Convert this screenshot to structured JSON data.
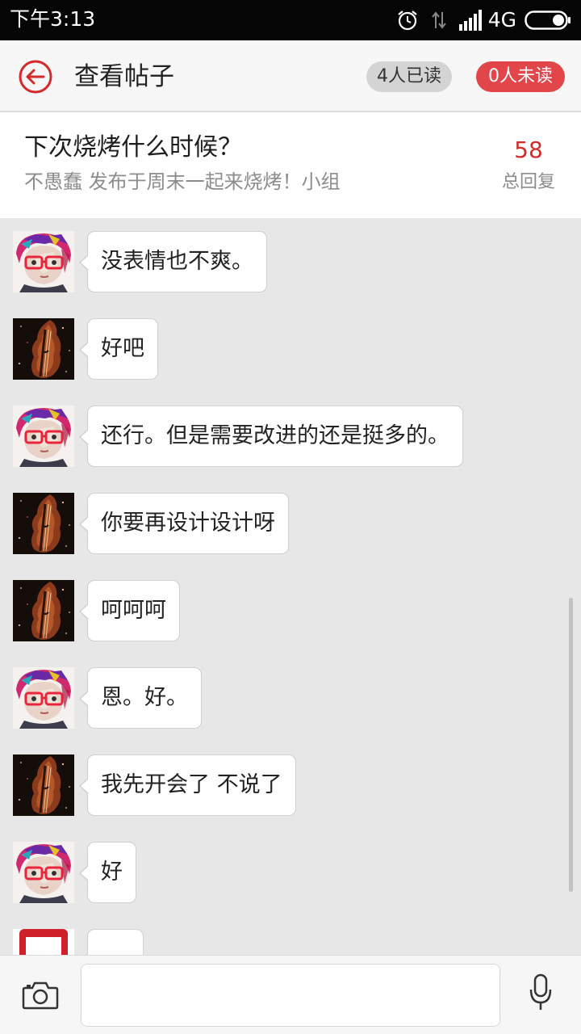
{
  "status_bar": {
    "time": "下午3:13",
    "network": "4G",
    "icons": [
      "alarm-icon",
      "data-transfer-icon",
      "signal-icon",
      "battery-icon"
    ]
  },
  "header": {
    "title": "查看帖子",
    "read_badge": "4人已读",
    "unread_badge": "0人未读",
    "back_icon": "back-arrow-icon",
    "accent_color": "#d32a2a",
    "unread_color": "#e2454a"
  },
  "post": {
    "title": "下次烧烤什么时候？",
    "meta": "不愚蠢 发布于周末一起来烧烤！小组",
    "reply_count": "58",
    "reply_label": "总回复"
  },
  "messages": [
    {
      "sender": "user-a",
      "text": "没表情也不爽。"
    },
    {
      "sender": "user-b",
      "text": "好吧"
    },
    {
      "sender": "user-a",
      "text": "还行。但是需要改进的还是挺多的。"
    },
    {
      "sender": "user-b",
      "text": "你要再设计设计呀"
    },
    {
      "sender": "user-b",
      "text": "呵呵呵"
    },
    {
      "sender": "user-a",
      "text": "恩。好。"
    },
    {
      "sender": "user-b",
      "text": "我先开会了 不说了"
    },
    {
      "sender": "user-a",
      "text": "好"
    },
    {
      "sender": "user-c",
      "text": ""
    }
  ],
  "input_bar": {
    "camera_icon": "camera-icon",
    "mic_icon": "microphone-icon",
    "value": "",
    "placeholder": ""
  }
}
